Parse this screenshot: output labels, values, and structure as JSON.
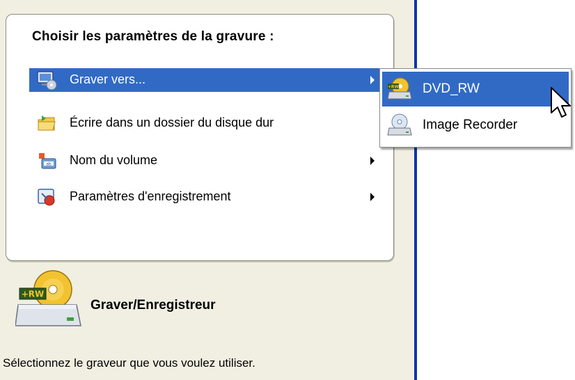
{
  "settings": {
    "title": "Choisir les paramètres de la gravure :",
    "menu_items": [
      {
        "label": "Graver vers...",
        "icon": "burn-to-icon",
        "has_submenu": true,
        "selected": true
      },
      {
        "label": "Écrire dans un dossier du disque dur",
        "icon": "folder-write-icon",
        "has_submenu": false,
        "selected": false
      },
      {
        "label": "Nom du volume",
        "icon": "volume-name-icon",
        "has_submenu": true,
        "selected": false
      },
      {
        "label": "Paramètres d'enregistrement",
        "icon": "recording-settings-icon",
        "has_submenu": true,
        "selected": false
      }
    ]
  },
  "submenu": {
    "items": [
      {
        "label": "DVD_RW",
        "icon": "dvd-rw-drive-icon",
        "selected": true
      },
      {
        "label": "Image Recorder",
        "icon": "image-recorder-icon",
        "selected": false
      }
    ]
  },
  "burner": {
    "title": "Graver/Enregistreur",
    "description": "Sélectionnez le graveur que vous voulez utiliser.",
    "icon": "rw-drive-icon",
    "badge": "+RW"
  },
  "colors": {
    "selection": "#316ac5",
    "divider": "#0a36a8",
    "panel_background": "#f0efe2"
  }
}
